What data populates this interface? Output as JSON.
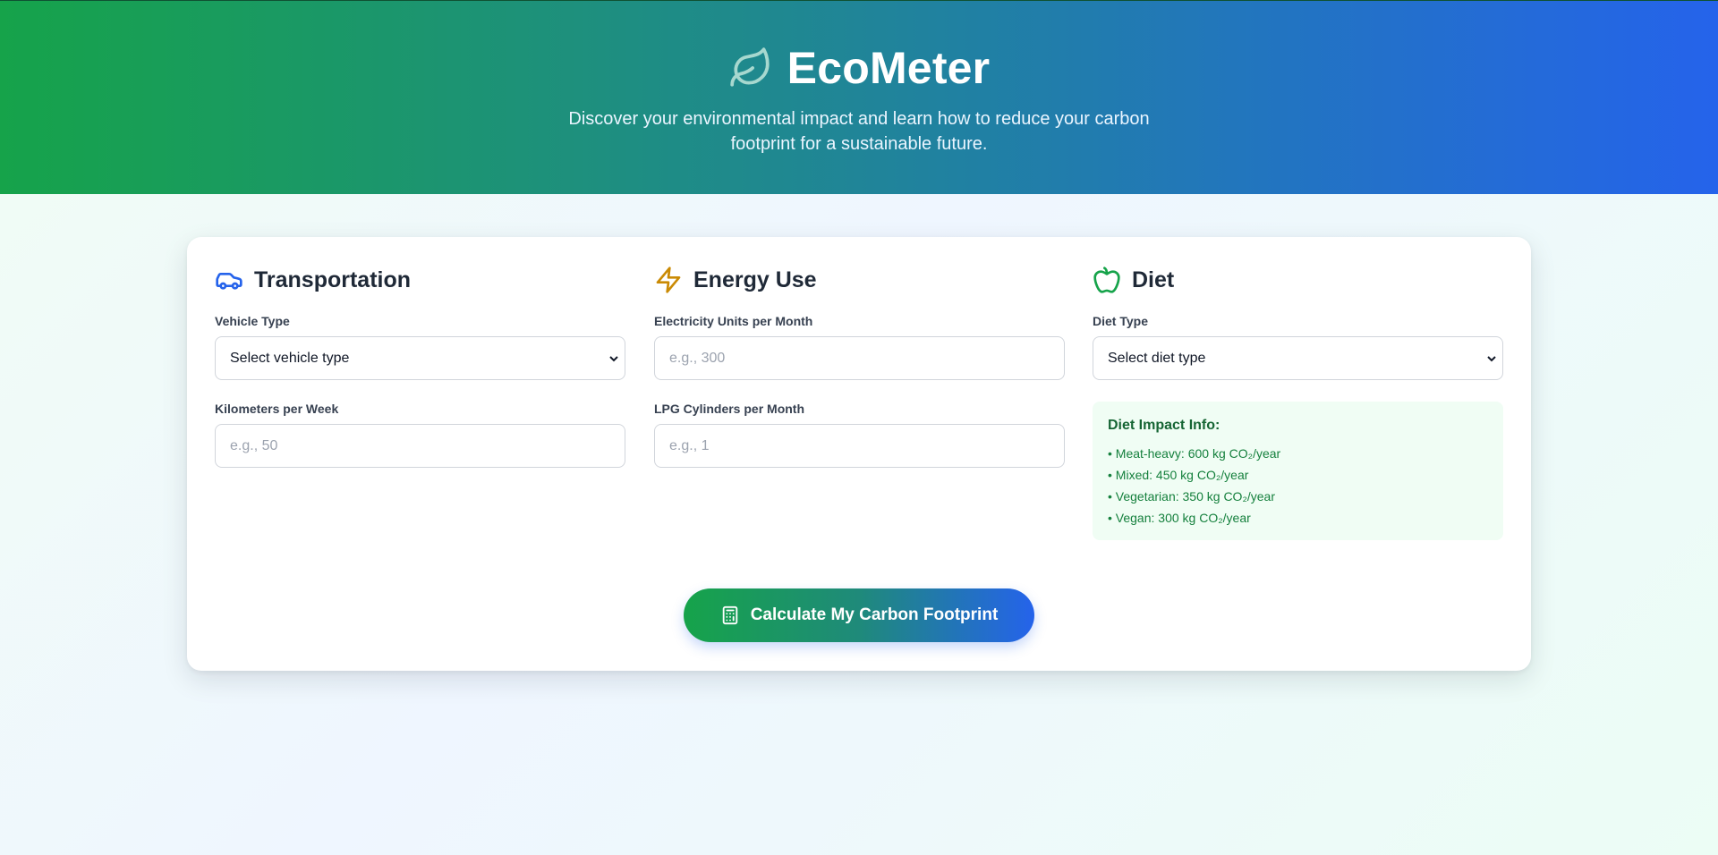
{
  "header": {
    "title": "EcoMeter",
    "subtitle": "Discover your environmental impact and learn how to reduce your carbon footprint for a sustainable future.",
    "icon": "leaf-icon"
  },
  "transportation": {
    "title": "Transportation",
    "icon": "car-icon",
    "vehicle_label": "Vehicle Type",
    "vehicle_value": "Select vehicle type",
    "km_label": "Kilometers per Week",
    "km_placeholder": "e.g., 50"
  },
  "energy": {
    "title": "Energy Use",
    "icon": "lightning-icon",
    "electricity_label": "Electricity Units per Month",
    "electricity_placeholder": "e.g., 300",
    "lpg_label": "LPG Cylinders per Month",
    "lpg_placeholder": "e.g., 1"
  },
  "diet": {
    "title": "Diet",
    "icon": "apple-icon",
    "diet_label": "Diet Type",
    "diet_value": "Select diet type",
    "info_title": "Diet Impact Info:",
    "info_items": [
      "• Meat-heavy: 600 kg CO₂/year",
      "• Mixed: 450 kg CO₂/year",
      "• Vegetarian: 350 kg CO₂/year",
      "• Vegan: 300 kg CO₂/year"
    ]
  },
  "action": {
    "label": "Calculate My Carbon Footprint",
    "icon": "calculator-icon"
  },
  "colors": {
    "green": "#16a34a",
    "blue": "#2563eb",
    "amber": "#ca8a04"
  }
}
